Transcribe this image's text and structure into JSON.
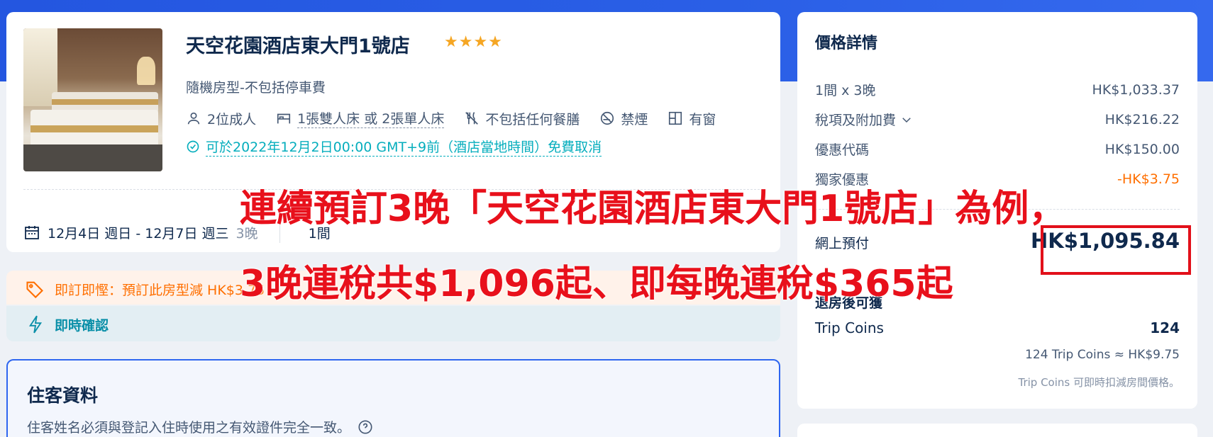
{
  "hotel": {
    "name": "天空花園酒店東大門1號店",
    "stars": "★★★★",
    "room_type": "隨機房型-不包括停車費",
    "amenities": {
      "guests": "2位成人",
      "bed": "1張雙人床 或 2張單人床",
      "meals": "不包括任何餐膳",
      "smoking": "禁煙",
      "window": "有窗"
    },
    "cancellation": "可於2022年12月2日00:00 GMT+9前（酒店當地時間）免費取消",
    "dates": "12月4日 週日 - 12月7日 週三",
    "nights": "3晚",
    "rooms": "1間"
  },
  "promo": {
    "deal": "即訂即慳：預訂此房型減 HK$3.75",
    "instant_confirm": "即時確認"
  },
  "guest": {
    "title": "住客資料",
    "note": "住客姓名必須與登記入住時使用之有效證件完全一致。"
  },
  "price": {
    "title": "價格詳情",
    "rows": [
      {
        "label": "1間 x 3晚",
        "value": "HK$1,033.37"
      },
      {
        "label": "稅項及附加費",
        "value": "HK$216.22"
      },
      {
        "label": "優惠代碼",
        "value": "HK$150.00"
      },
      {
        "label": "獨家優惠",
        "value": "-HK$3.75"
      }
    ],
    "online_label": "網上預付",
    "online_total": "HK$1,095.84",
    "after_label": "退房後可獲",
    "coins_label": "Trip Coins",
    "coins_value": "124",
    "coins_conversion": "124 Trip Coins ≈ HK$9.75",
    "coins_note": "Trip Coins 可即時扣減房間價格。"
  },
  "overlay": {
    "line1": "連續預訂3晚「天空花園酒店東大門1號店」為例，",
    "line2": "3晚連稅共$1,096起、即每晚連稅$365起"
  },
  "colors": {
    "accent_blue": "#2f66f0",
    "orange": "#ff6f00",
    "teal": "#06aebd",
    "annotation_red": "#e8101b",
    "star": "#f5a623"
  }
}
